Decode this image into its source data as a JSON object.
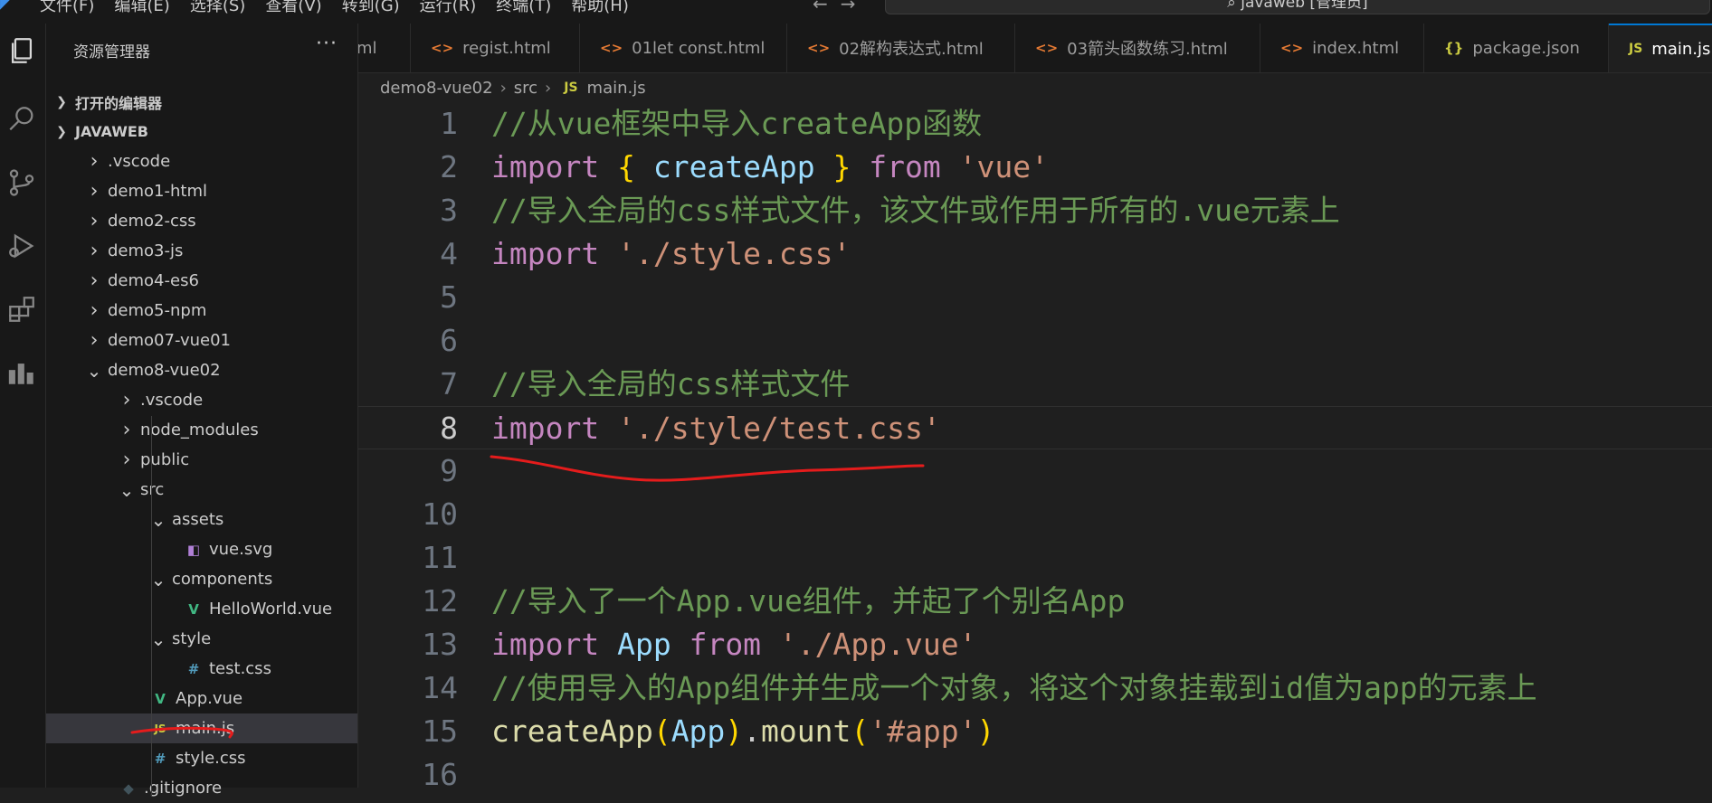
{
  "menubar": {
    "items": [
      "文件(F)",
      "编辑(E)",
      "选择(S)",
      "查看(V)",
      "转到(G)",
      "运行(R)",
      "终端(T)",
      "帮助(H)"
    ],
    "search_text": "javaweb [管理员]"
  },
  "sidebar": {
    "title": "资源管理器",
    "open_editors": "打开的编辑器",
    "root": "JAVAWEB",
    "tree": [
      {
        "label": ".vscode",
        "depth": 1,
        "kind": "folder",
        "expanded": false
      },
      {
        "label": "demo1-html",
        "depth": 1,
        "kind": "folder",
        "expanded": false
      },
      {
        "label": "demo2-css",
        "depth": 1,
        "kind": "folder",
        "expanded": false
      },
      {
        "label": "demo3-js",
        "depth": 1,
        "kind": "folder",
        "expanded": false
      },
      {
        "label": "demo4-es6",
        "depth": 1,
        "kind": "folder",
        "expanded": false
      },
      {
        "label": "demo5-npm",
        "depth": 1,
        "kind": "folder",
        "expanded": false
      },
      {
        "label": "demo07-vue01",
        "depth": 1,
        "kind": "folder",
        "expanded": false
      },
      {
        "label": "demo8-vue02",
        "depth": 1,
        "kind": "folder",
        "expanded": true
      },
      {
        "label": ".vscode",
        "depth": 2,
        "kind": "folder",
        "expanded": false
      },
      {
        "label": "node_modules",
        "depth": 2,
        "kind": "folder",
        "expanded": false
      },
      {
        "label": "public",
        "depth": 2,
        "kind": "folder",
        "expanded": false
      },
      {
        "label": "src",
        "depth": 2,
        "kind": "folder",
        "expanded": true
      },
      {
        "label": "assets",
        "depth": 3,
        "kind": "folder",
        "expanded": true
      },
      {
        "label": "vue.svg",
        "depth": 4,
        "kind": "svg"
      },
      {
        "label": "components",
        "depth": 3,
        "kind": "folder",
        "expanded": true
      },
      {
        "label": "HelloWorld.vue",
        "depth": 4,
        "kind": "vue"
      },
      {
        "label": "style",
        "depth": 3,
        "kind": "folder",
        "expanded": true
      },
      {
        "label": "test.css",
        "depth": 4,
        "kind": "css"
      },
      {
        "label": "App.vue",
        "depth": 3,
        "kind": "vue"
      },
      {
        "label": "main.js",
        "depth": 3,
        "kind": "js",
        "selected": true
      },
      {
        "label": "style.css",
        "depth": 3,
        "kind": "css"
      },
      {
        "label": ".gitignore",
        "depth": 2,
        "kind": "git"
      }
    ]
  },
  "tabs": [
    {
      "label": "ml",
      "icon": ""
    },
    {
      "label": "regist.html",
      "icon": "<>"
    },
    {
      "label": "01let const.html",
      "icon": "<>"
    },
    {
      "label": "02解构表达式.html",
      "icon": "<>"
    },
    {
      "label": "03箭头函数练习.html",
      "icon": "<>"
    },
    {
      "label": "index.html",
      "icon": "<>"
    },
    {
      "label": "package.json",
      "icon": "{}"
    },
    {
      "label": "main.js",
      "icon": "JS",
      "active": true
    }
  ],
  "breadcrumb": {
    "parts": [
      "demo8-vue02",
      "src"
    ],
    "file_icon": "JS",
    "file": "main.js"
  },
  "editor": {
    "current_line": 8,
    "lines": [
      {
        "n": "1",
        "tokens": [
          [
            "c",
            "//从vue框架中导入createApp函数"
          ]
        ]
      },
      {
        "n": "2",
        "tokens": [
          [
            "k",
            "import"
          ],
          [
            "pl",
            " "
          ],
          [
            "p",
            "{"
          ],
          [
            "pl",
            " "
          ],
          [
            "v",
            "createApp"
          ],
          [
            "pl",
            " "
          ],
          [
            "p",
            "}"
          ],
          [
            "pl",
            " "
          ],
          [
            "k",
            "from"
          ],
          [
            "pl",
            " "
          ],
          [
            "s",
            "'vue'"
          ]
        ]
      },
      {
        "n": "3",
        "tokens": [
          [
            "c",
            "//导入全局的css样式文件，该文件或作用于所有的.vue元素上"
          ]
        ]
      },
      {
        "n": "4",
        "tokens": [
          [
            "k",
            "import"
          ],
          [
            "pl",
            " "
          ],
          [
            "s",
            "'./style.css'"
          ]
        ]
      },
      {
        "n": "5",
        "tokens": []
      },
      {
        "n": "6",
        "tokens": []
      },
      {
        "n": "7",
        "tokens": [
          [
            "c",
            "//导入全局的css样式文件"
          ]
        ]
      },
      {
        "n": "8",
        "tokens": [
          [
            "k",
            "import"
          ],
          [
            "pl",
            " "
          ],
          [
            "s",
            "'./style/test.css'"
          ]
        ]
      },
      {
        "n": "9",
        "tokens": []
      },
      {
        "n": "10",
        "tokens": []
      },
      {
        "n": "11",
        "tokens": []
      },
      {
        "n": "12",
        "tokens": [
          [
            "c",
            "//导入了一个App.vue组件，并起了个别名App"
          ]
        ]
      },
      {
        "n": "13",
        "tokens": [
          [
            "k",
            "import"
          ],
          [
            "pl",
            " "
          ],
          [
            "v",
            "App"
          ],
          [
            "pl",
            " "
          ],
          [
            "k",
            "from"
          ],
          [
            "pl",
            " "
          ],
          [
            "s",
            "'./App.vue'"
          ]
        ]
      },
      {
        "n": "14",
        "tokens": [
          [
            "c",
            "//使用导入的App组件并生成一个对象，将这个对象挂载到id值为app的元素上"
          ]
        ]
      },
      {
        "n": "15",
        "tokens": [
          [
            "f",
            "createApp"
          ],
          [
            "p",
            "("
          ],
          [
            "v",
            "App"
          ],
          [
            "p",
            ")"
          ],
          [
            "pl",
            "."
          ],
          [
            "f",
            "mount"
          ],
          [
            "p",
            "("
          ],
          [
            "s",
            "'#app'"
          ],
          [
            "p",
            ")"
          ]
        ]
      },
      {
        "n": "16",
        "tokens": []
      }
    ]
  },
  "colors": {
    "accent": "#0078d4",
    "annotation": "#e51c1c",
    "vue": "#41b883",
    "js": "#cbcb41",
    "css": "#519aba",
    "html": "#e37933"
  }
}
